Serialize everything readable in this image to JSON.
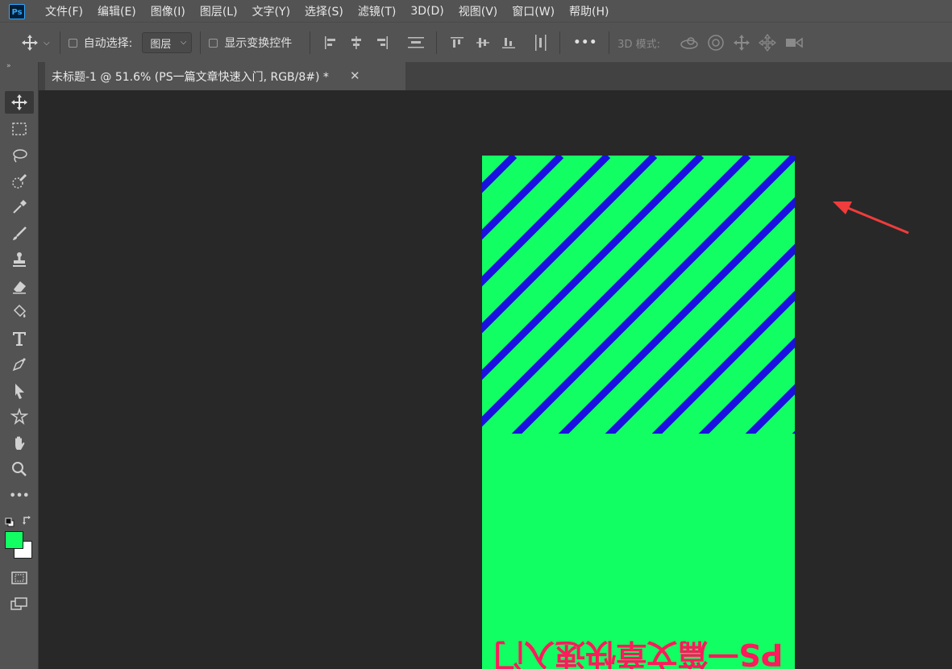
{
  "app": {
    "logo_text": "Ps"
  },
  "menu": [
    "文件(F)",
    "编辑(E)",
    "图像(I)",
    "图层(L)",
    "文字(Y)",
    "选择(S)",
    "滤镜(T)",
    "3D(D)",
    "视图(V)",
    "窗口(W)",
    "帮助(H)"
  ],
  "options": {
    "auto_select_label": "自动选择:",
    "auto_select_value": "图层",
    "show_transform_label": "显示变换控件",
    "more_label": "•••",
    "mode_3d_label": "3D 模式:"
  },
  "document_tab": {
    "title": "未标题-1 @ 51.6% (PS一篇文章快速入门, RGB/8#) *",
    "close_glyph": "✕"
  },
  "toolbar": {
    "grip": "»",
    "more_label": "•••"
  },
  "canvas": {
    "background_color": "#12ff63",
    "stripe_color": "#1a10e0",
    "text_color": "#ff1a5b",
    "text_layer": "PS一篇文章快速入门"
  },
  "colors": {
    "foreground": "#12ff63",
    "background": "#ffffff",
    "annotation_arrow": "#f03c3c"
  }
}
